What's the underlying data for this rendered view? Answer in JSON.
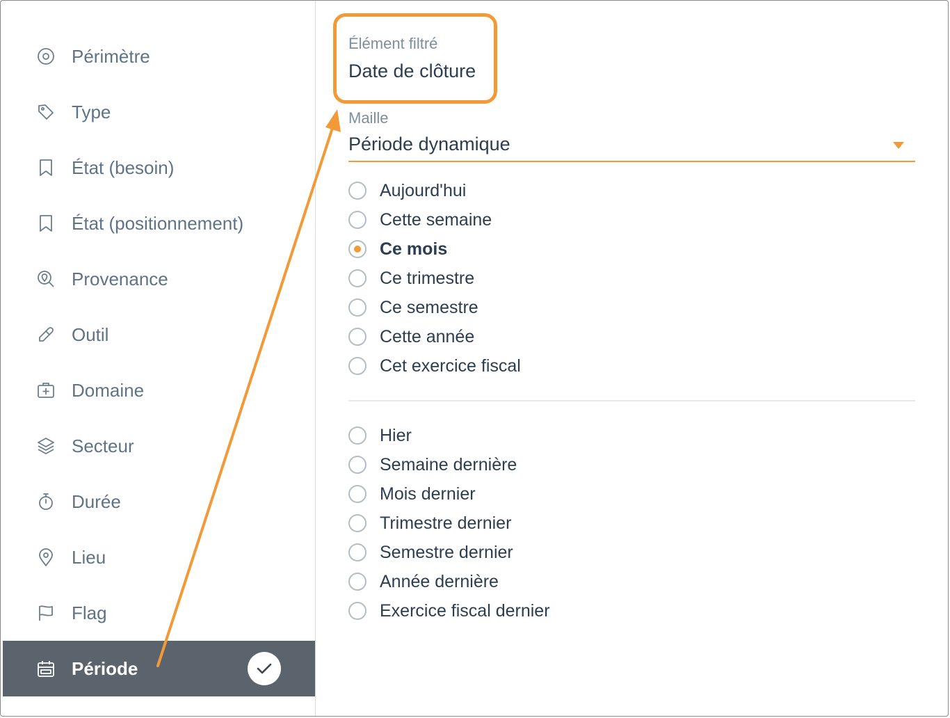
{
  "sidebar": {
    "items": [
      {
        "label": "Périmètre",
        "icon": "target-icon"
      },
      {
        "label": "Type",
        "icon": "tag-icon"
      },
      {
        "label": "État (besoin)",
        "icon": "bookmark-icon"
      },
      {
        "label": "État (positionnement)",
        "icon": "bookmark-icon"
      },
      {
        "label": "Provenance",
        "icon": "search-location-icon"
      },
      {
        "label": "Outil",
        "icon": "tool-icon"
      },
      {
        "label": "Domaine",
        "icon": "medical-case-icon"
      },
      {
        "label": "Secteur",
        "icon": "layers-icon"
      },
      {
        "label": "Durée",
        "icon": "stopwatch-icon"
      },
      {
        "label": "Lieu",
        "icon": "map-pin-icon"
      },
      {
        "label": "Flag",
        "icon": "flag-icon"
      },
      {
        "label": "Période",
        "icon": "calendar-icon",
        "active": true,
        "checked": true
      }
    ]
  },
  "filter": {
    "caption": "Élément filtré",
    "value": "Date de clôture"
  },
  "maille": {
    "caption": "Maille",
    "selected": "Période dynamique"
  },
  "options": {
    "current": [
      {
        "label": "Aujourd'hui",
        "selected": false
      },
      {
        "label": "Cette semaine",
        "selected": false
      },
      {
        "label": "Ce mois",
        "selected": true
      },
      {
        "label": "Ce trimestre",
        "selected": false
      },
      {
        "label": "Ce semestre",
        "selected": false
      },
      {
        "label": "Cette année",
        "selected": false
      },
      {
        "label": "Cet exercice fiscal",
        "selected": false
      }
    ],
    "previous": [
      {
        "label": "Hier",
        "selected": false
      },
      {
        "label": "Semaine dernière",
        "selected": false
      },
      {
        "label": "Mois dernier",
        "selected": false
      },
      {
        "label": "Trimestre dernier",
        "selected": false
      },
      {
        "label": "Semestre dernier",
        "selected": false
      },
      {
        "label": "Année dernière",
        "selected": false
      },
      {
        "label": "Exercice fiscal dernier",
        "selected": false
      }
    ]
  },
  "colors": {
    "accent": "#f29a38",
    "sidebar_text": "#5f7387",
    "active_bg": "#5b646c",
    "text": "#2c3e50"
  }
}
